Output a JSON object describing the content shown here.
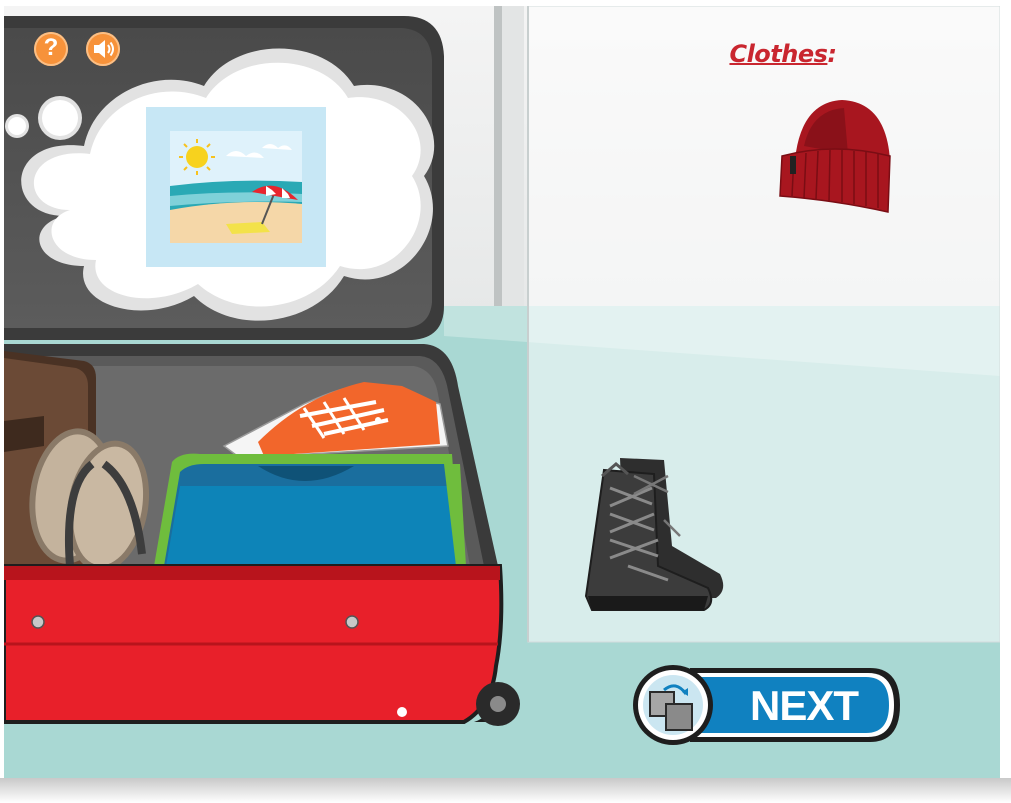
{
  "panel": {
    "title": "Clothes",
    "title_suffix": ":"
  },
  "buttons": {
    "help_icon": "?",
    "next_label": "NEXT"
  },
  "thought_bubble": {
    "destination": "beach"
  },
  "suitcase_items": [
    "leather-bag",
    "flip-flops",
    "orange-sneakers",
    "blue-t-shirt"
  ],
  "clothing_items": [
    "red-beanie-hat",
    "black-snowboard-boots"
  ],
  "colors": {
    "accent_orange": "#f7923a",
    "suitcase_red": "#e8202a",
    "title_red": "#c9262f",
    "next_blue": "#1081c0",
    "floor": "#a9d8d3"
  }
}
